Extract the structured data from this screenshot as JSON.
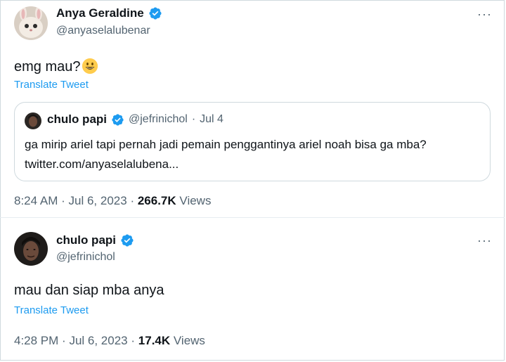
{
  "tweet1": {
    "display_name": "Anya Geraldine",
    "handle": "@anyaselalubenar",
    "text": "emg mau?",
    "emoji": "grinning-face-emoji",
    "translate_label": "Translate Tweet",
    "time": "8:24 AM",
    "date": "Jul 6, 2023",
    "views_count": "266.7K",
    "views_label": "Views",
    "more_label": "···"
  },
  "quote": {
    "display_name": "chulo papi",
    "handle": "@jefrinichol",
    "date": "Jul 4",
    "text_line1": "ga mirip ariel tapi pernah jadi pemain penggantinya ariel noah bisa ga mba?",
    "text_line2": "twitter.com/anyaselalubena..."
  },
  "tweet2": {
    "display_name": "chulo papi",
    "handle": "@jefrinichol",
    "text": "mau dan siap mba anya",
    "translate_label": "Translate Tweet",
    "time": "4:28 PM",
    "date": "Jul 6, 2023",
    "views_count": "17.4K",
    "views_label": "Views",
    "more_label": "···"
  },
  "colors": {
    "verified": "#1d9bf0",
    "link": "#1d9bf0",
    "secondary_text": "#536471",
    "primary_text": "#0f1419"
  },
  "separator": "·"
}
